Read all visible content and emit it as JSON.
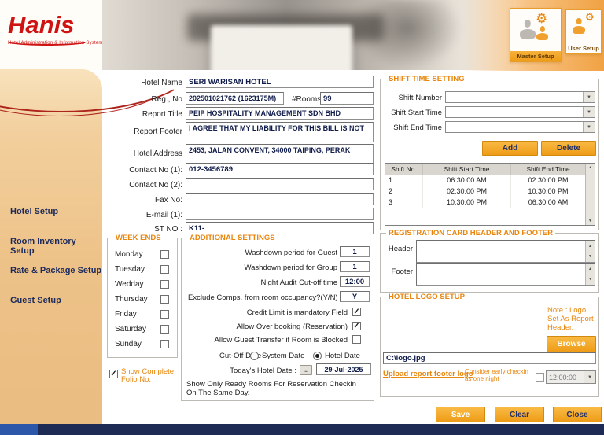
{
  "brand": {
    "name": "Hanis",
    "tagline": "Hotel Administration & Information System"
  },
  "top_nav": {
    "master_setup": "Master Setup",
    "user_setup": "User Setup"
  },
  "sidebar": {
    "items": [
      {
        "label": "Hotel Setup"
      },
      {
        "label": "Room Inventory Setup"
      },
      {
        "label": "Rate & Package Setup"
      },
      {
        "label": "Guest Setup"
      }
    ]
  },
  "folio_option": {
    "label": "Show Complete Folio No.",
    "checked": true
  },
  "hotel_form": {
    "hotel_name": {
      "label": "Hotel Name",
      "value": "SERI WARISAN HOTEL"
    },
    "reg_no": {
      "label": "Reg., No",
      "value": "202501021762 (1623175M)"
    },
    "rooms": {
      "label": "#Rooms",
      "value": "99"
    },
    "report_title": {
      "label": "Report Title",
      "value": "PEIP HOSPITALITY MANAGEMENT SDN BHD"
    },
    "report_footer": {
      "label": "Report Footer",
      "value": "I AGREE THAT MY LIABILITY FOR THIS BILL IS NOT"
    },
    "hotel_address": {
      "label": "Hotel Address",
      "value": "2453, JALAN CONVENT, 34000 TAIPING, PERAK"
    },
    "contact1": {
      "label": "Contact No  (1):",
      "value": "012-3456789"
    },
    "contact2": {
      "label": "Contact No  (2):",
      "value": ""
    },
    "fax": {
      "label": "Fax No:",
      "value": ""
    },
    "email": {
      "label": "E-mail (1):",
      "value": ""
    },
    "st_no": {
      "label": "ST NO :",
      "value": "K11-"
    }
  },
  "week_ends": {
    "title": "WEEK ENDS",
    "days": [
      {
        "label": "Monday",
        "checked": false
      },
      {
        "label": "Tuesday",
        "checked": false
      },
      {
        "label": "Wedday",
        "checked": false
      },
      {
        "label": "Thursday",
        "checked": false
      },
      {
        "label": "Friday",
        "checked": false
      },
      {
        "label": "Saturday",
        "checked": false
      },
      {
        "label": "Sunday",
        "checked": false
      }
    ]
  },
  "additional_settings": {
    "title": "ADDITIONAL SETTINGS",
    "rows": [
      {
        "label": "Washdown period for Guest",
        "value": "1"
      },
      {
        "label": "Washdown period for Group",
        "value": "1"
      },
      {
        "label": "Night Audit Cut-off time",
        "value": "12:00"
      },
      {
        "label": "Exclude Comps. from room occupancy?(Y/N)",
        "value": "Y"
      }
    ],
    "checks": [
      {
        "label": "Credit Limit is  mandatory Field",
        "checked": true
      },
      {
        "label": "Allow Over booking (Reservation)",
        "checked": true
      },
      {
        "label": "Allow Guest Transfer if Room is Blocked",
        "checked": false
      }
    ],
    "cutoff": {
      "label": "Cut-Off Date",
      "options": [
        {
          "label": "System Date",
          "selected": false
        },
        {
          "label": "Hotel Date",
          "selected": true
        }
      ]
    },
    "today": {
      "label": "Today's Hotel Date :",
      "browse": "...",
      "value": "29-Jul-2025"
    },
    "note": "Show Only Ready Rooms For Reservation Checkin On The Same Day."
  },
  "shift_time": {
    "title": "SHIFT TIME SETTING",
    "fields": [
      {
        "label": "Shift Number",
        "value": ""
      },
      {
        "label": "Shift Start Time",
        "value": ""
      },
      {
        "label": "Shift End Time",
        "value": ""
      }
    ],
    "add_label": "Add",
    "delete_label": "Delete",
    "table": {
      "headers": [
        "Shift No.",
        "Shift Start Time",
        "Shift End Time"
      ],
      "rows": [
        [
          "1",
          "06:30:00 AM",
          "02:30:00 PM"
        ],
        [
          "2",
          "02:30:00 PM",
          "10:30:00 PM"
        ],
        [
          "3",
          "10:30:00 PM",
          "06:30:00 AM"
        ]
      ]
    }
  },
  "registration_card": {
    "title": "REGISTRATION CARD HEADER AND FOOTER",
    "header_label": "Header",
    "header_value": "",
    "footer_label": "Footer",
    "footer_value": ""
  },
  "hotel_logo": {
    "title": "HOTEL LOGO SETUP",
    "note": "Note : Logo Set As Report Header.",
    "browse_label": "Browse",
    "logo_path": "C:\\logo.jpg",
    "upload_link": "Upload report footer logo",
    "early_checkin_label": "Consider early checkin as one night",
    "early_checkin_checked": false,
    "early_checkin_time": "12:00:00"
  },
  "footer_actions": {
    "save": "Save",
    "clear": "Clear",
    "close": "Close"
  },
  "colors": {
    "accent_orange": "#ee9c17",
    "title_orange": "#e8860d",
    "navy": "#1e2b55",
    "brand_red": "#cf1212"
  }
}
